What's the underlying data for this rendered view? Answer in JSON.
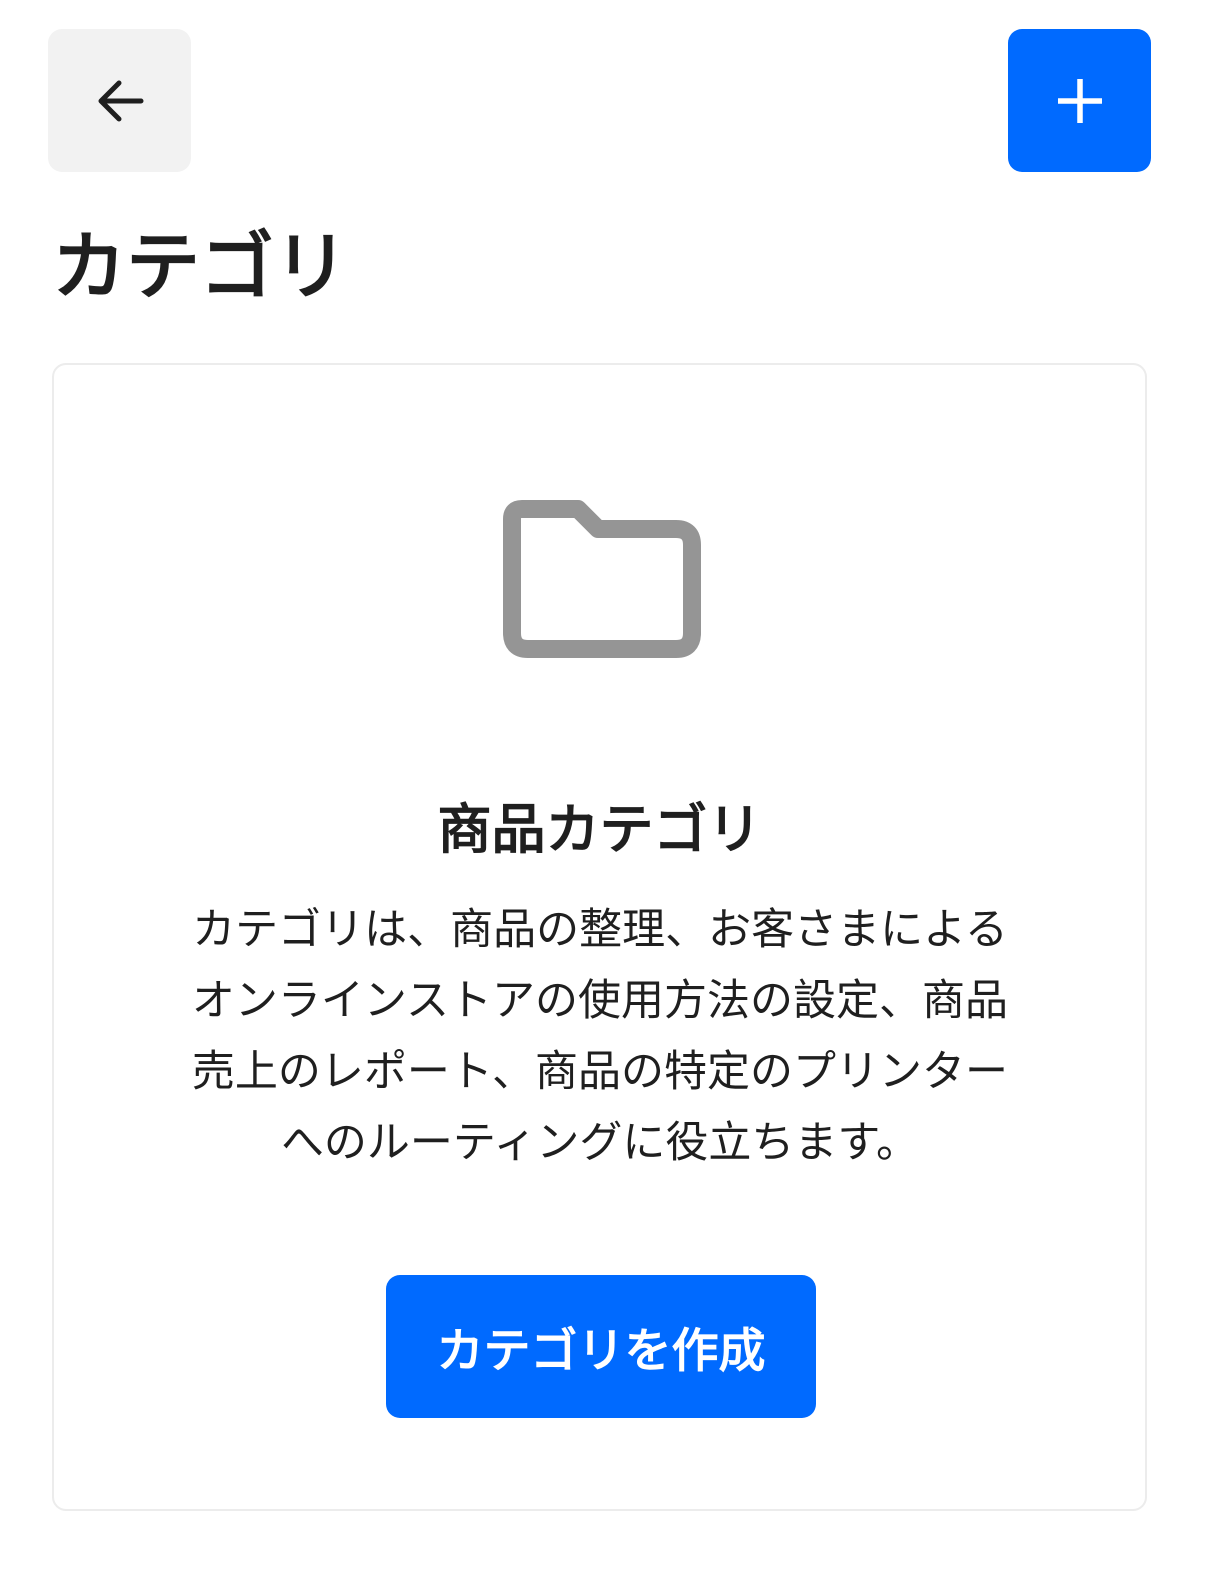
{
  "header": {
    "back_icon": "arrow-left-icon",
    "add_icon": "plus-icon"
  },
  "page": {
    "title": "カテゴリ"
  },
  "empty_state": {
    "icon": "folder-icon",
    "title": "商品カテゴリ",
    "description_lines": [
      "カテゴリは、商品の整理、お客さまによる",
      "オンラインストアの使用方法の設定、商品",
      "売上のレポート、商品の特定のプリンター",
      "へのルーティングに役立ちます。"
    ],
    "button_label": "カテゴリを作成"
  },
  "colors": {
    "accent": "#006aff",
    "neutral_button": "#f2f2f2",
    "icon_gray": "#959595",
    "text": "#1f1f1f"
  }
}
